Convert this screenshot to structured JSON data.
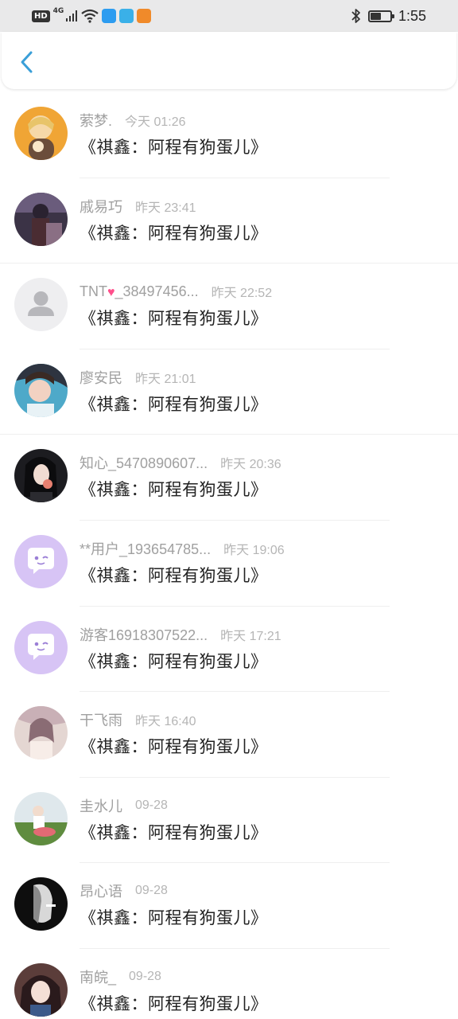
{
  "status_bar": {
    "hd": "HD",
    "network": "4G",
    "time": "1:55",
    "battery_level": 0.55,
    "app_colors": [
      "#2d9cf0",
      "#3ab0e8",
      "#f08a2a"
    ]
  },
  "header": {
    "back_icon": "chevron-left-icon",
    "accent": "#3a9fd8"
  },
  "messages": [
    {
      "name": "萦梦.",
      "time": "今天 01:26",
      "text": "《祺鑫：阿程有狗蛋儿》"
    },
    {
      "name": "戚易巧",
      "time": "昨天 23:41",
      "text": "《祺鑫：阿程有狗蛋儿》"
    },
    {
      "name_pre": "TNT",
      "name_post": "_38497456...",
      "time": "昨天 22:52",
      "text": "《祺鑫：阿程有狗蛋儿》"
    },
    {
      "name": "廖安民",
      "time": "昨天 21:01",
      "text": "《祺鑫：阿程有狗蛋儿》"
    },
    {
      "name": "知心_5470890607...",
      "time": "昨天 20:36",
      "text": "《祺鑫：阿程有狗蛋儿》"
    },
    {
      "name": "**用户_193654785...",
      "time": "昨天 19:06",
      "text": "《祺鑫：阿程有狗蛋儿》"
    },
    {
      "name": "游客16918307522...",
      "time": "昨天 17:21",
      "text": "《祺鑫：阿程有狗蛋儿》"
    },
    {
      "name": "干飞雨",
      "time": "昨天 16:40",
      "text": "《祺鑫：阿程有狗蛋儿》"
    },
    {
      "name": "圭水儿",
      "time": "09-28",
      "text": "《祺鑫：阿程有狗蛋儿》"
    },
    {
      "name": "昂心语",
      "time": "09-28",
      "text": "《祺鑫：阿程有狗蛋儿》"
    },
    {
      "name": "南皖_",
      "time": "09-28",
      "text": "《祺鑫：阿程有狗蛋儿》"
    }
  ]
}
